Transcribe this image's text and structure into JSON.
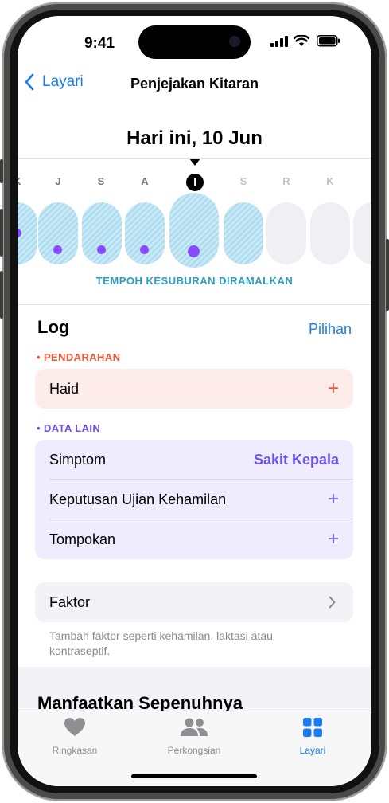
{
  "status_bar": {
    "time": "9:41"
  },
  "nav": {
    "back_label": "Layari",
    "title": "Penjejakan Kitaran"
  },
  "calendar": {
    "date_title": "Hari ini, 10 Jun",
    "days": [
      {
        "letter": "K",
        "state": "past",
        "fertile": true,
        "logged": true
      },
      {
        "letter": "J",
        "state": "past",
        "fertile": true,
        "logged": true
      },
      {
        "letter": "S",
        "state": "past",
        "fertile": true,
        "logged": true
      },
      {
        "letter": "A",
        "state": "past",
        "fertile": true,
        "logged": true
      },
      {
        "letter": "I",
        "state": "today",
        "fertile": true,
        "logged": true
      },
      {
        "letter": "S",
        "state": "future",
        "fertile": true,
        "logged": false
      },
      {
        "letter": "R",
        "state": "future",
        "fertile": false,
        "logged": false
      },
      {
        "letter": "K",
        "state": "future",
        "fertile": false,
        "logged": false
      },
      {
        "letter": "",
        "state": "future",
        "fertile": false,
        "logged": false
      }
    ],
    "fertile_label": "TEMPOH KESUBURAN DIRAMALKAN"
  },
  "log": {
    "title": "Log",
    "options_label": "Pilihan",
    "bleeding": {
      "header": "PENDARAHAN",
      "rows": [
        {
          "label": "Haid",
          "action": "+"
        }
      ]
    },
    "other_data": {
      "header": "DATA LAIN",
      "rows": [
        {
          "label": "Simptom",
          "value": "Sakit Kepala"
        },
        {
          "label": "Keputusan Ujian Kehamilan",
          "action": "+"
        },
        {
          "label": "Tompokan",
          "action": "+"
        }
      ]
    },
    "factors": {
      "label": "Faktor",
      "note": "Tambah faktor seperti kehamilan, laktasi atau kontraseptif."
    }
  },
  "more": {
    "title": "Manfaatkan Sepenuhnya"
  },
  "tab_bar": {
    "tabs": [
      {
        "label": "Ringkasan",
        "icon": "heart-icon",
        "active": false
      },
      {
        "label": "Perkongsian",
        "icon": "people-icon",
        "active": false
      },
      {
        "label": "Layari",
        "icon": "grid-icon",
        "active": true
      }
    ]
  },
  "colors": {
    "accent": "#1a7cf4",
    "bleeding": "#f0573a",
    "other_data": "#6e4ff0",
    "fertile": "#2a9ec0",
    "log_dot": "#8a4bff"
  }
}
